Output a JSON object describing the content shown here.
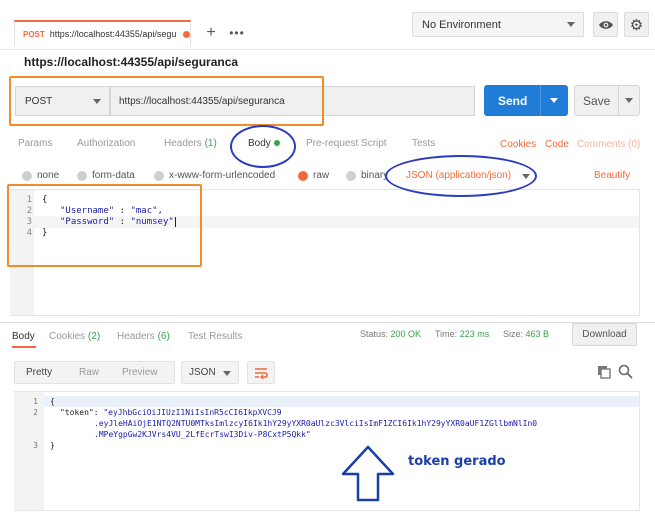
{
  "tab": {
    "method": "POST",
    "url": "https://localhost:44355/api/segu"
  },
  "environment": {
    "selected": "No Environment"
  },
  "request": {
    "title": "https://localhost:44355/api/seguranca",
    "method": "POST",
    "url": "https://localhost:44355/api/seguranca",
    "send_label": "Send",
    "save_label": "Save"
  },
  "request_tabs": {
    "params": "Params",
    "authorization": "Authorization",
    "headers": "Headers",
    "headers_count": "(1)",
    "body": "Body",
    "prerequest": "Pre-request Script",
    "tests": "Tests",
    "cookies": "Cookies",
    "code": "Code",
    "comments": "Comments (0)"
  },
  "body_types": {
    "none": "none",
    "form_data": "form-data",
    "urlencoded": "x-www-form-urlencoded",
    "raw": "raw",
    "binary": "binary",
    "content_type": "JSON (application/json)",
    "beautify": "Beautify"
  },
  "editor": {
    "line_numbers": [
      "1",
      "2",
      "3",
      "4"
    ],
    "l1": "{",
    "l2_key": "\"Username\"",
    "l2_rest": " : ",
    "l2_val": "\"mac\",",
    "l3_key": "\"Password\"",
    "l3_rest": " : ",
    "l3_val": "\"numsey\"",
    "l4": "}"
  },
  "response_tabs": {
    "body": "Body",
    "cookies": "Cookies",
    "cookies_count": "(2)",
    "headers": "Headers",
    "headers_count": "(6)",
    "tests": "Test Results"
  },
  "response_meta": {
    "status_label": "Status:",
    "status_value": "200 OK",
    "time_label": "Time:",
    "time_value": "223 ms",
    "size_label": "Size:",
    "size_value": "463 B",
    "download": "Download"
  },
  "response_toolbar": {
    "pretty": "Pretty",
    "raw": "Raw",
    "preview": "Preview",
    "format": "JSON"
  },
  "response_body": {
    "line_numbers": [
      "1",
      "2",
      "3"
    ],
    "l1": "{",
    "l2_key": "\"token\"",
    "l2_sep": ": ",
    "l2_val_a": "\"eyJhbGciOiJIUzI1NiIsInR5cCI6IkpXVCJ9",
    "l2_val_b": ".eyJleHAiOjE1NTQ2NTU0MTksImlzcyI6Ik1hY29yYXR0aUlzc3VlciIsImF1ZCI6Ik1hY29yYXR0aUF1ZGllbmNlIn0",
    "l2_val_c": ".MPeYgpGw2KJVrs4VU_2LfEcrTswI3Div-P8CxtP5Qkk\"",
    "l3": "}"
  },
  "annotation": {
    "label": "token gerado"
  },
  "colors": {
    "accent": "#f26b3a",
    "send": "#1f7dd8",
    "status_ok": "#37a548",
    "annotation_orange": "#f28c2a",
    "annotation_blue": "#2b3bbf"
  }
}
